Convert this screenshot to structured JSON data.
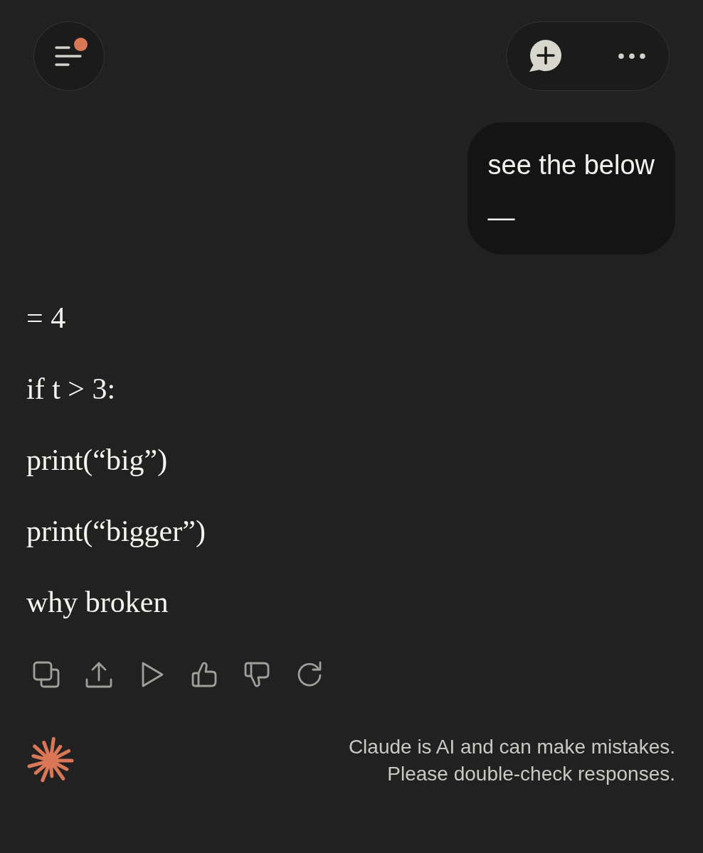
{
  "header": {
    "menu_button": {
      "unread": true
    }
  },
  "user_message": {
    "lines": [
      "see the below",
      "—"
    ]
  },
  "response": {
    "paragraphs": [
      "= 4",
      "if t > 3:",
      "print(“big”)",
      "print(“bigger”)",
      "why broken"
    ]
  },
  "disclaimer": {
    "lines": [
      "Claude is AI and can make mistakes.",
      "Please double-check responses."
    ]
  }
}
